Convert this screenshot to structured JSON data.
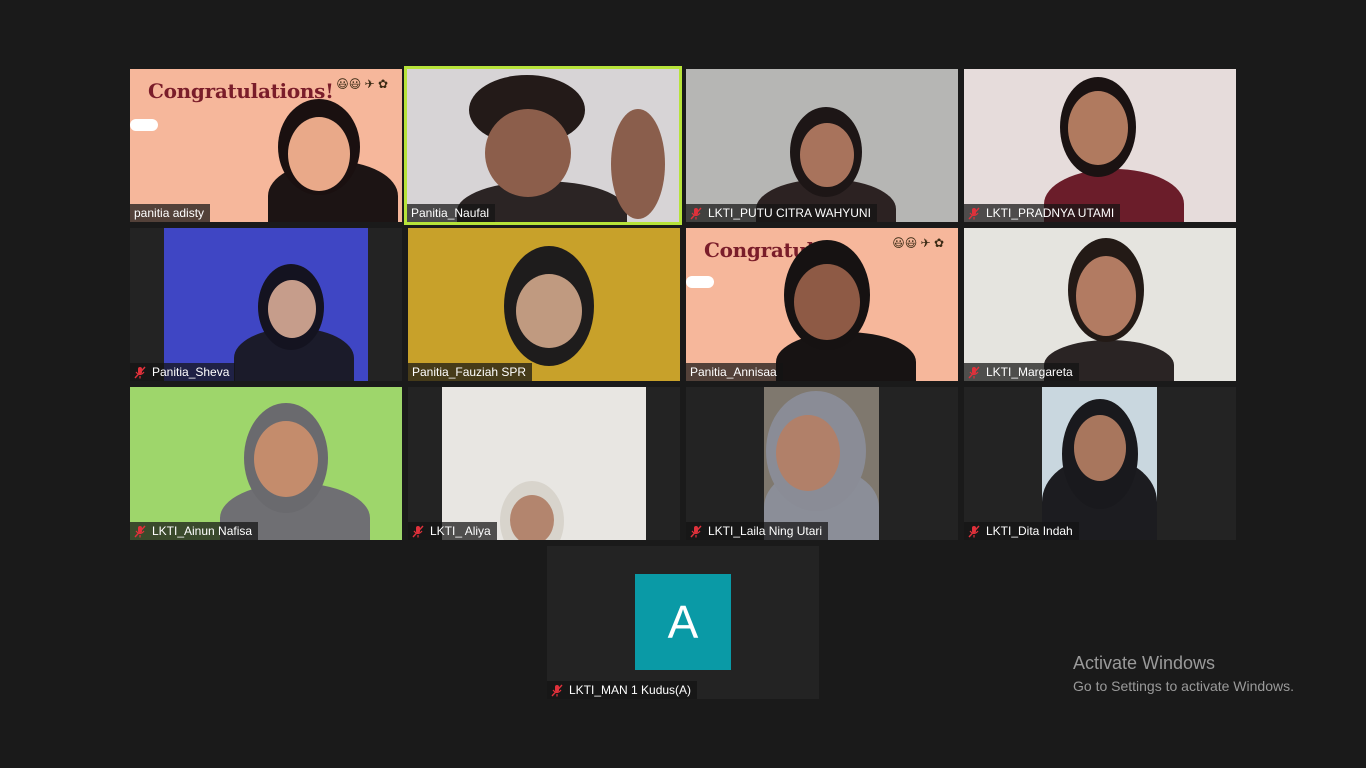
{
  "meeting": {
    "participants": [
      {
        "name": "panitia adisty",
        "muted": false,
        "active_speaker": false,
        "background": "Congratulations!"
      },
      {
        "name": "Panitia_Naufal",
        "muted": false,
        "active_speaker": true
      },
      {
        "name": "LKTI_PUTU CITRA WAHYUNI",
        "muted": true,
        "active_speaker": false
      },
      {
        "name": "LKTI_PRADNYA UTAMI",
        "muted": true,
        "active_speaker": false
      },
      {
        "name": "Panitia_Sheva",
        "muted": true,
        "active_speaker": false
      },
      {
        "name": "Panitia_Fauziah SPR",
        "muted": false,
        "active_speaker": false
      },
      {
        "name": "Panitia_Annisaa",
        "muted": false,
        "active_speaker": false,
        "background": "Congratula"
      },
      {
        "name": "LKTI_Margareta",
        "muted": true,
        "active_speaker": false
      },
      {
        "name": "LKTI_Ainun Nafisa",
        "muted": true,
        "active_speaker": false
      },
      {
        "name": "LKTI_ Aliya",
        "muted": true,
        "active_speaker": false
      },
      {
        "name": "LKTI_Laila Ning Utari",
        "muted": true,
        "active_speaker": false
      },
      {
        "name": "LKTI_Dita Indah",
        "muted": true,
        "active_speaker": false
      },
      {
        "name": "LKTI_MAN 1 Kudus(A)",
        "muted": true,
        "active_speaker": false,
        "avatar_letter": "A"
      }
    ]
  },
  "overlay": {
    "activate_title": "Activate Windows",
    "activate_sub": "Go to Settings to activate Windows."
  },
  "colors": {
    "background": "#1a1a1a",
    "tile": "#232323",
    "active_border": "#b7e33a",
    "avatar": "#0a9aa6",
    "mute_red": "#e0313b"
  },
  "icons": {
    "mute": "microphone-muted-icon"
  }
}
